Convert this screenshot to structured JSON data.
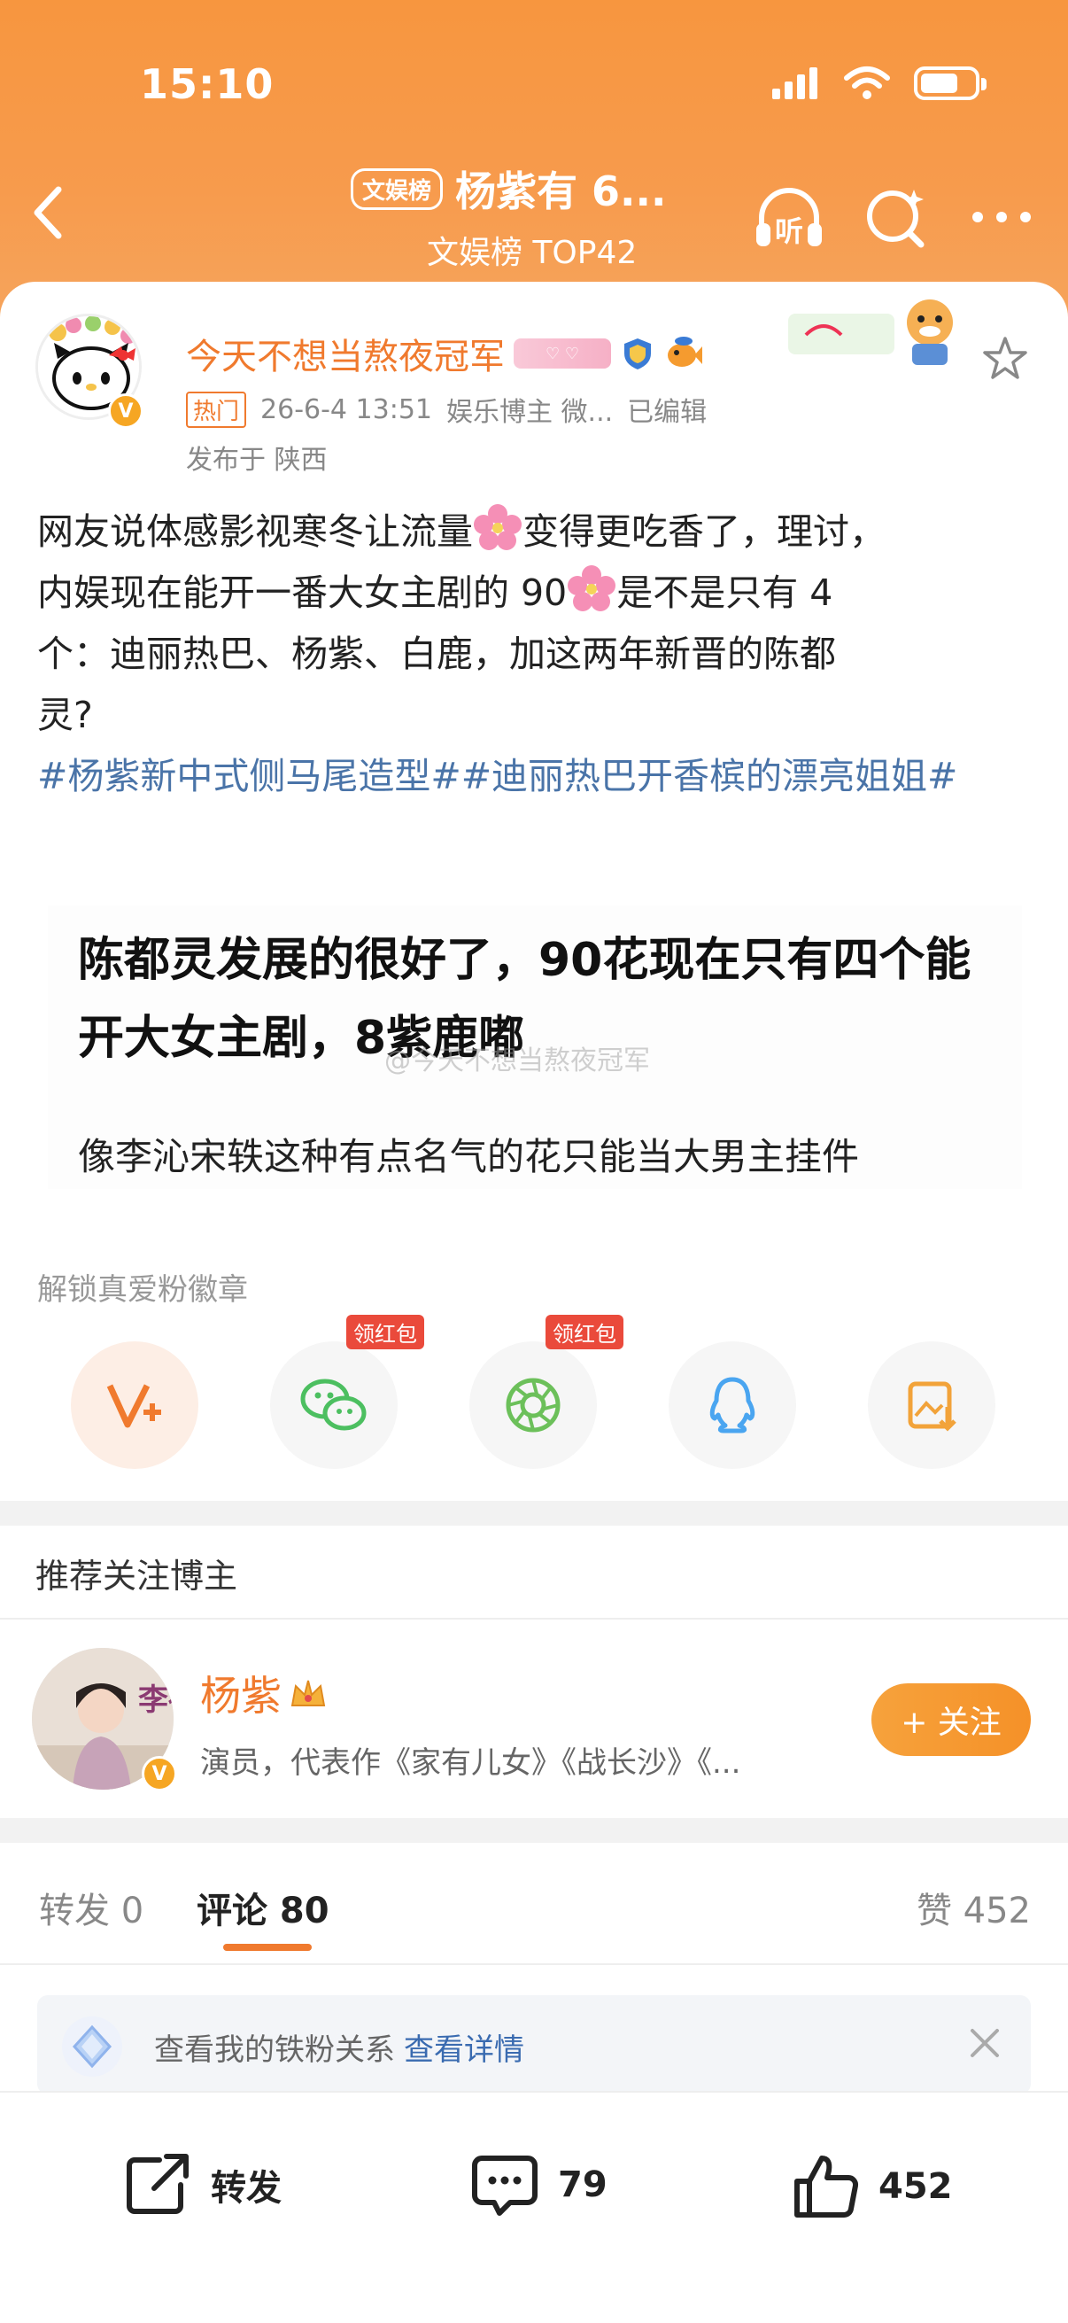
{
  "status_bar": {
    "time": "15:10"
  },
  "nav": {
    "tag": "文娱榜",
    "title": "杨紫有 6...",
    "subtitle": "文娱榜 TOP42",
    "listen_label": "听"
  },
  "post": {
    "author": "今天不想当熬夜冠军",
    "hot_tag": "热门",
    "timestamp": "26-6-4 13:51",
    "source": "娱乐博主 微...",
    "edited": "已编辑",
    "location": "发布于 陕西",
    "body_line1_a": "网友说体感影视寒冬让流量",
    "body_line1_b": "变得更吃香了，理讨，",
    "body_line2_a": "内娱现在能开一番大女主剧的 90",
    "body_line2_b": "是不是只有 4",
    "body_line3": "个：迪丽热巴、杨紫、白鹿，加这两年新晋的陈都",
    "body_line4": "灵?",
    "hashtags": "#杨紫新中式侧马尾造型##迪丽热巴开香槟的漂亮姐姐#"
  },
  "quote_image": {
    "title": "陈都灵发展的很好了，90花现在只有四个能开大女主剧，8紫鹿嘟",
    "subtitle": "像李沁宋轶这种有点名气的花只能当大男主挂件",
    "watermark": "@今天不想当熬夜冠军"
  },
  "share": {
    "unlock_label": "解锁真爱粉徽章",
    "red_packet_label": "领红包",
    "buttons": [
      "vplus-icon",
      "wechat-icon",
      "moments-icon",
      "qq-icon",
      "save-image-icon"
    ]
  },
  "recommend": {
    "section_title": "推荐关注博主",
    "name": "杨紫",
    "desc": "演员，代表作《家有儿女》《战长沙》《...",
    "follow_label": "+ 关注",
    "avatar_text": "李祯"
  },
  "tabs": {
    "repost": "转发 0",
    "comments": "评论 80",
    "likes": "赞 452"
  },
  "fan_banner": {
    "text": "查看我的铁粉关系",
    "link": "查看详情"
  },
  "bottom_bar": {
    "repost": "转发",
    "comments": "79",
    "likes": "452"
  },
  "colors": {
    "brand_orange": "#f07a2e",
    "header_gradient_top": "#f7963f",
    "link_blue": "#4a74a8"
  }
}
